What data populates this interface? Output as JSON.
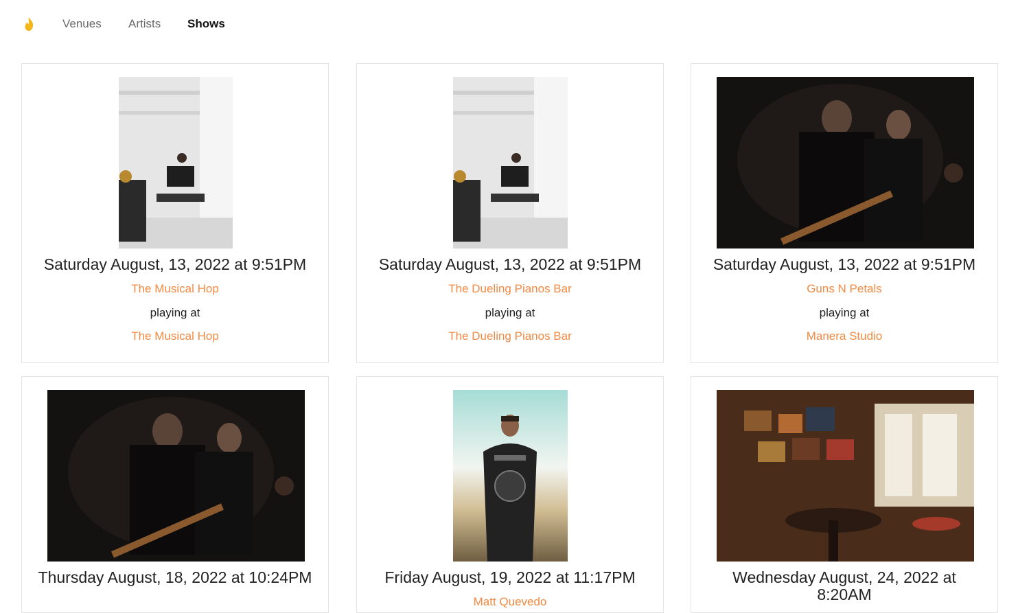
{
  "nav": {
    "logo_icon": "flame-icon",
    "items": [
      {
        "label": "Venues"
      },
      {
        "label": "Artists"
      },
      {
        "label": "Shows"
      }
    ],
    "active": "Shows",
    "accent_color": "#f5b51c"
  },
  "shows": [
    {
      "image": "studio-piano-photo",
      "date": "Saturday August, 13, 2022 at 9:51PM",
      "artist": "The Musical Hop",
      "playing_at": "playing at",
      "venue": "The Musical Hop"
    },
    {
      "image": "studio-piano-photo",
      "date": "Saturday August, 13, 2022 at 9:51PM",
      "artist": "The Dueling Pianos Bar",
      "playing_at": "playing at",
      "venue": "The Dueling Pianos Bar"
    },
    {
      "image": "band-guitar-photo",
      "date": "Saturday August, 13, 2022 at 9:51PM",
      "artist": "Guns N Petals",
      "playing_at": "playing at",
      "venue": "Manera Studio"
    },
    {
      "image": "band-guitar-photo",
      "date": "Thursday August, 18, 2022 at 10:24PM"
    },
    {
      "image": "man-nirvana-shirt-photo",
      "date": "Friday August, 19, 2022 at 11:17PM",
      "artist": "Matt Quevedo"
    },
    {
      "image": "pub-interior-photo",
      "date": "Wednesday August, 24, 2022 at 8:20AM"
    }
  ],
  "colors": {
    "link": "#f28a43",
    "text": "#222222",
    "card_border": "#e3e3e3"
  }
}
